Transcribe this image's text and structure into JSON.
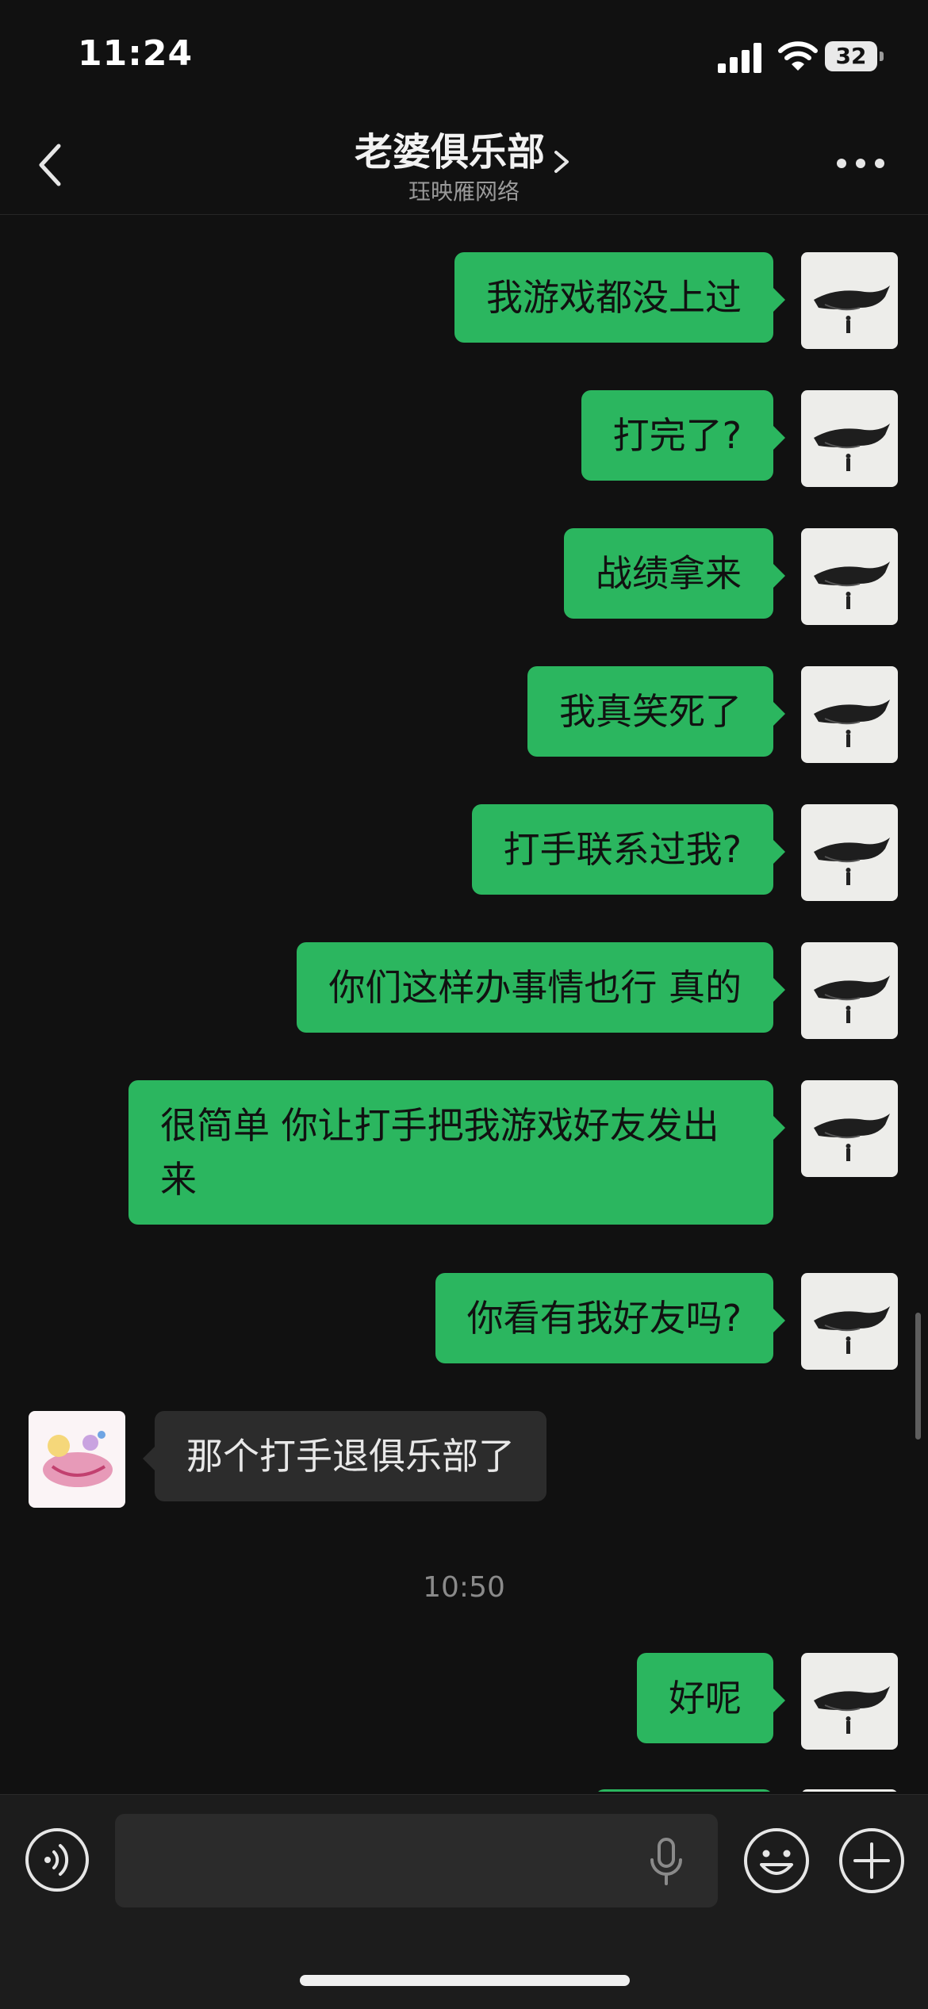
{
  "status_bar": {
    "time": "11:24",
    "battery": "32"
  },
  "header": {
    "title": "老婆俱乐部",
    "subtitle": "珏映雁网络"
  },
  "messages": [
    {
      "text": "我游戏都没上过"
    },
    {
      "text": "打完了?"
    },
    {
      "text": "战绩拿来"
    },
    {
      "text": "我真笑死了"
    },
    {
      "text": "打手联系过我?"
    },
    {
      "text": "你们这样办事情也行 真的"
    },
    {
      "text": "很简单 你让打手把我游戏好友发出来"
    },
    {
      "text": "你看有我好友吗?"
    },
    {
      "text": "那个打手退俱乐部了"
    },
    {
      "text": "好呢"
    }
  ],
  "timestamp": "10:50",
  "colors": {
    "outgoing_bubble": "#2bb65f",
    "incoming_bubble": "#2c2c2c",
    "background": "#111111"
  },
  "icons": {
    "back": "chevron-left-icon",
    "title_more": "chevron-right-icon",
    "menu": "ellipsis-icon",
    "voice": "voice-mode-icon",
    "mic": "microphone-icon",
    "emoji": "emoji-icon",
    "add": "plus-icon"
  }
}
